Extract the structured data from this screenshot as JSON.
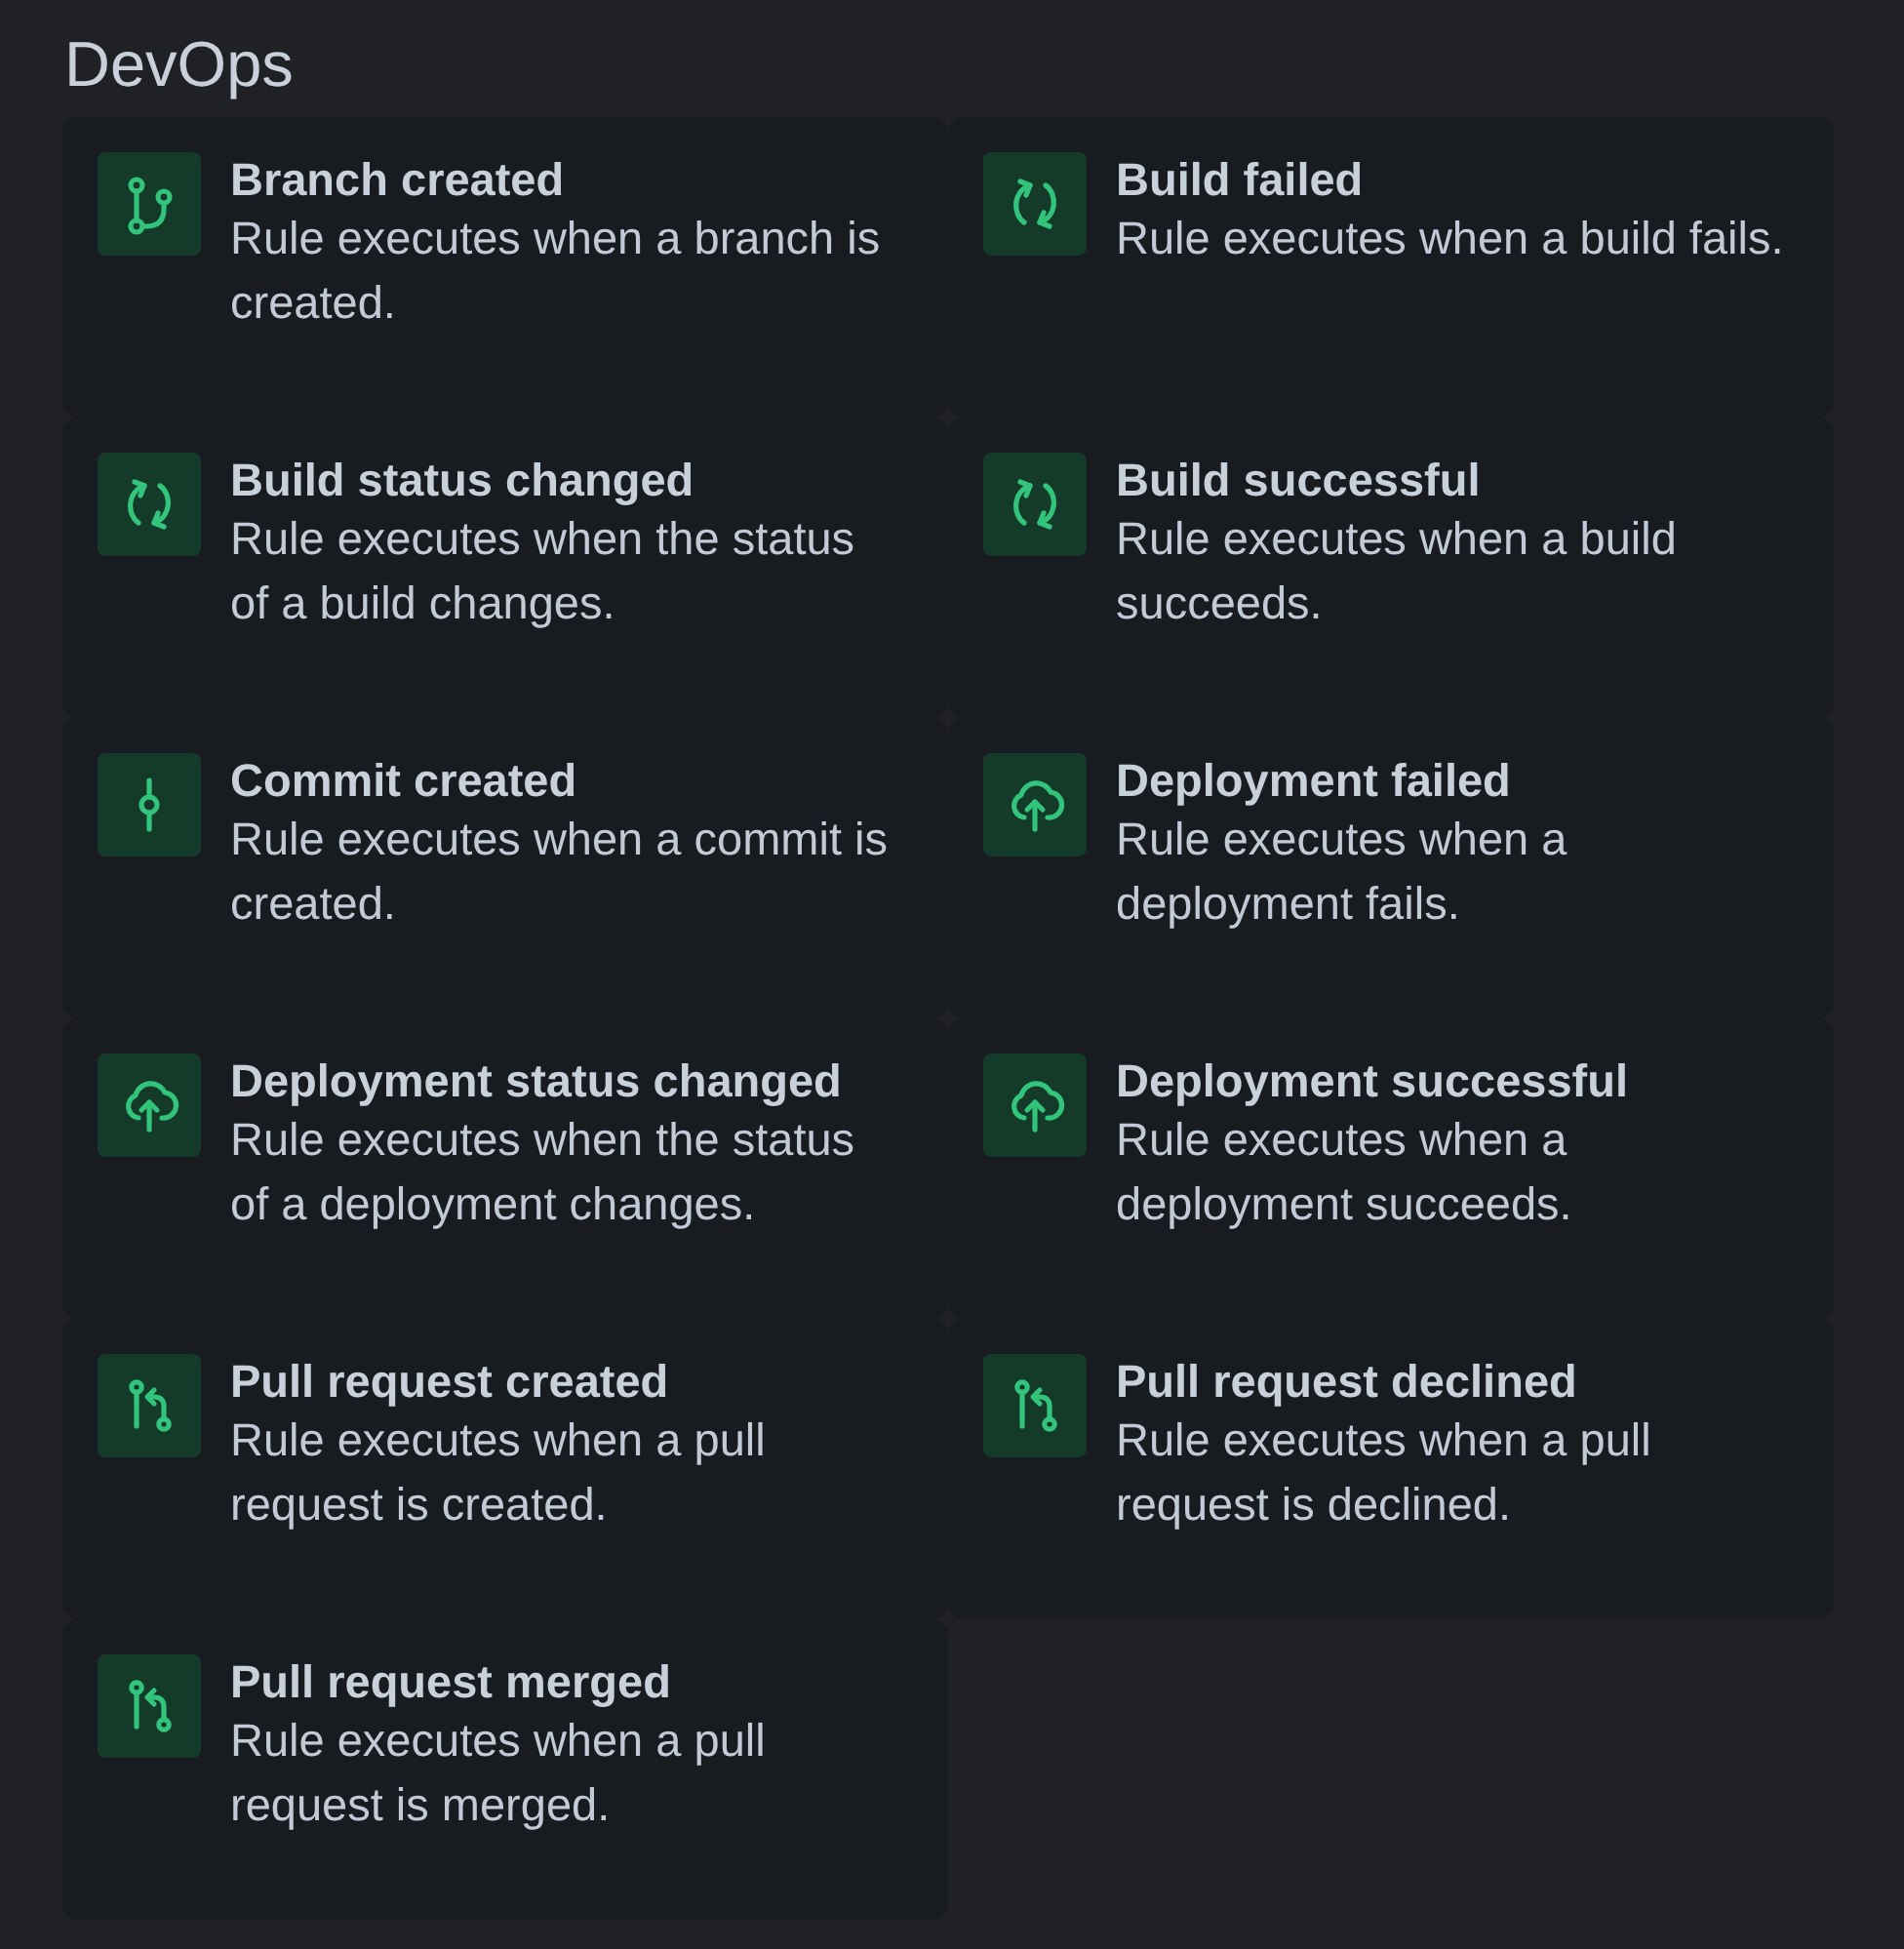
{
  "section": {
    "title": "DevOps"
  },
  "triggers": [
    {
      "kind": "branch",
      "title": "Branch created",
      "description": "Rule executes when a branch is created."
    },
    {
      "kind": "build",
      "title": "Build failed",
      "description": "Rule executes when a build fails."
    },
    {
      "kind": "build",
      "title": "Build status changed",
      "description": "Rule executes when the status of a build changes."
    },
    {
      "kind": "build",
      "title": "Build successful",
      "description": "Rule executes when a build succeeds."
    },
    {
      "kind": "commit",
      "title": "Commit created",
      "description": "Rule executes when a commit is created."
    },
    {
      "kind": "deployment",
      "title": "Deployment failed",
      "description": "Rule executes when a deployment fails."
    },
    {
      "kind": "deployment",
      "title": "Deployment status changed",
      "description": "Rule executes when the status of a deployment changes."
    },
    {
      "kind": "deployment",
      "title": "Deployment successful",
      "description": "Rule executes when a deployment succeeds."
    },
    {
      "kind": "pullrequest",
      "title": "Pull request created",
      "description": "Rule executes when a pull request is created."
    },
    {
      "kind": "pullrequest",
      "title": "Pull request declined",
      "description": "Rule executes when a pull request is declined."
    },
    {
      "kind": "pullrequest",
      "title": "Pull request merged",
      "description": "Rule executes when a pull request is merged."
    }
  ]
}
